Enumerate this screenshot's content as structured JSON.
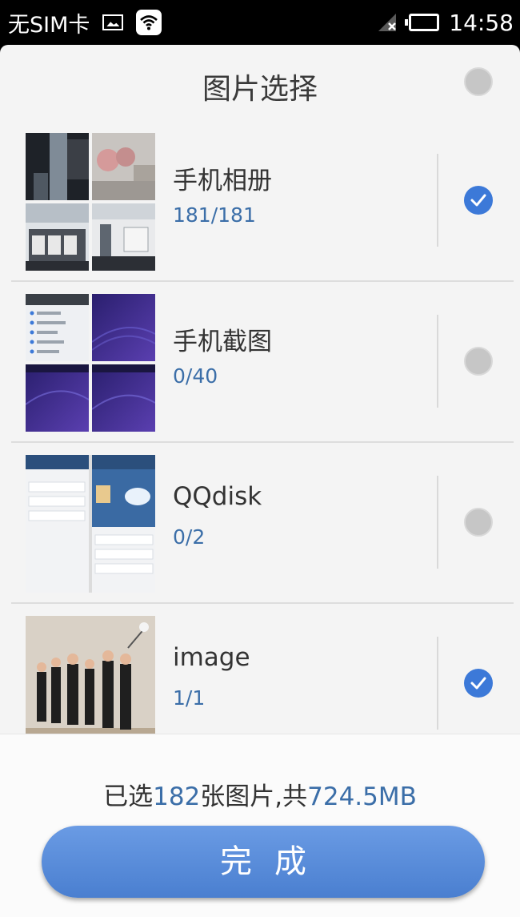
{
  "status_bar": {
    "carrier": "无SIM卡",
    "time": "14:58",
    "icons": [
      "image-icon",
      "wifi-icon",
      "signal-icon",
      "battery-icon"
    ]
  },
  "header": {
    "title": "图片选择",
    "select_all_checked": false
  },
  "albums": [
    {
      "name": "手机相册",
      "count": "181/181",
      "checked": true
    },
    {
      "name": "手机截图",
      "count": "0/40",
      "checked": false
    },
    {
      "name": "QQdisk",
      "count": "0/2",
      "checked": false
    },
    {
      "name": "image",
      "count": "1/1",
      "checked": true
    }
  ],
  "footer": {
    "summary_prefix": "已选",
    "selected_count": "182",
    "summary_mid": "张图片,共",
    "total_size": "724.5MB",
    "done_label": "完成"
  },
  "colors": {
    "accent": "#3c79d8",
    "count_text": "#3b6ea8",
    "panel_bg": "#f4f4f4",
    "unchecked": "#c6c6c6"
  }
}
